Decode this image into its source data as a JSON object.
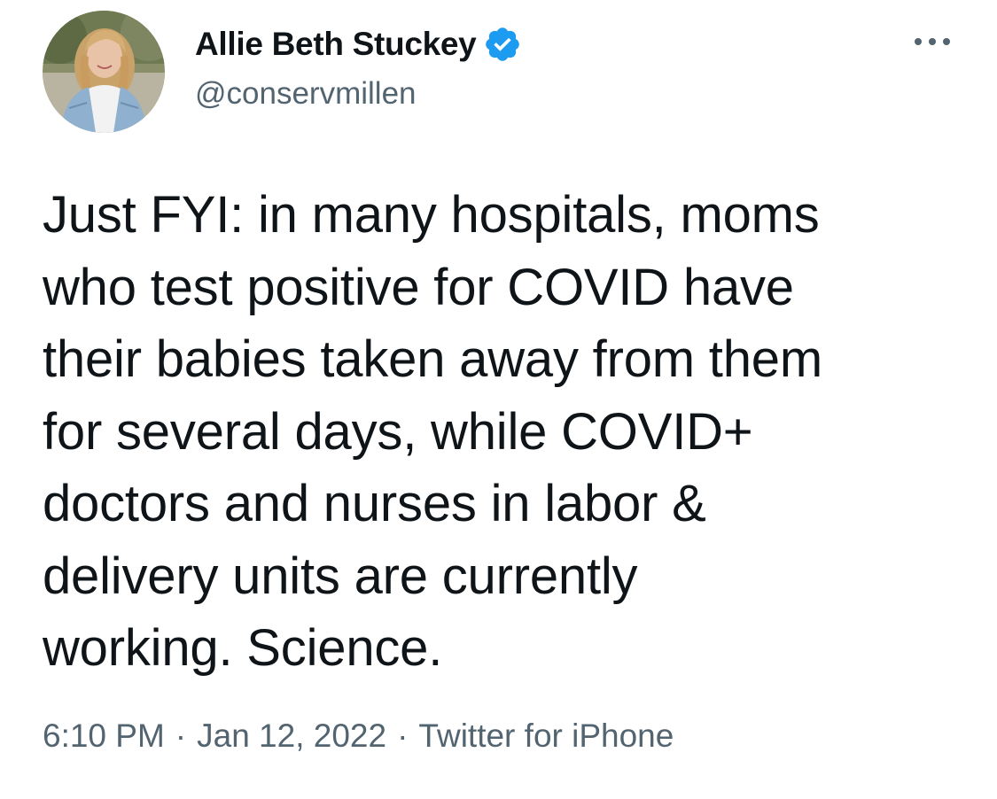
{
  "author": {
    "display_name": "Allie Beth Stuckey",
    "handle": "@conservmillen",
    "verified": true,
    "verified_icon": "verified-badge-icon",
    "verified_color": "#1d9bf0"
  },
  "tweet": {
    "text_lines": [
      "Just FYI: in many hospitals, moms",
      "who test positive for COVID have",
      "their babies taken away from them",
      "for several days, while COVID+",
      "doctors and nurses in labor &",
      "delivery units are currently",
      "working. Science."
    ]
  },
  "meta": {
    "time": "6:10 PM",
    "separator": "·",
    "date": "Jan 12, 2022",
    "source": "Twitter for iPhone"
  },
  "menu": {
    "icon": "more-options-icon"
  },
  "colors": {
    "text_primary": "#0f1419",
    "text_secondary": "#536471",
    "accent": "#1d9bf0",
    "background": "#ffffff"
  }
}
